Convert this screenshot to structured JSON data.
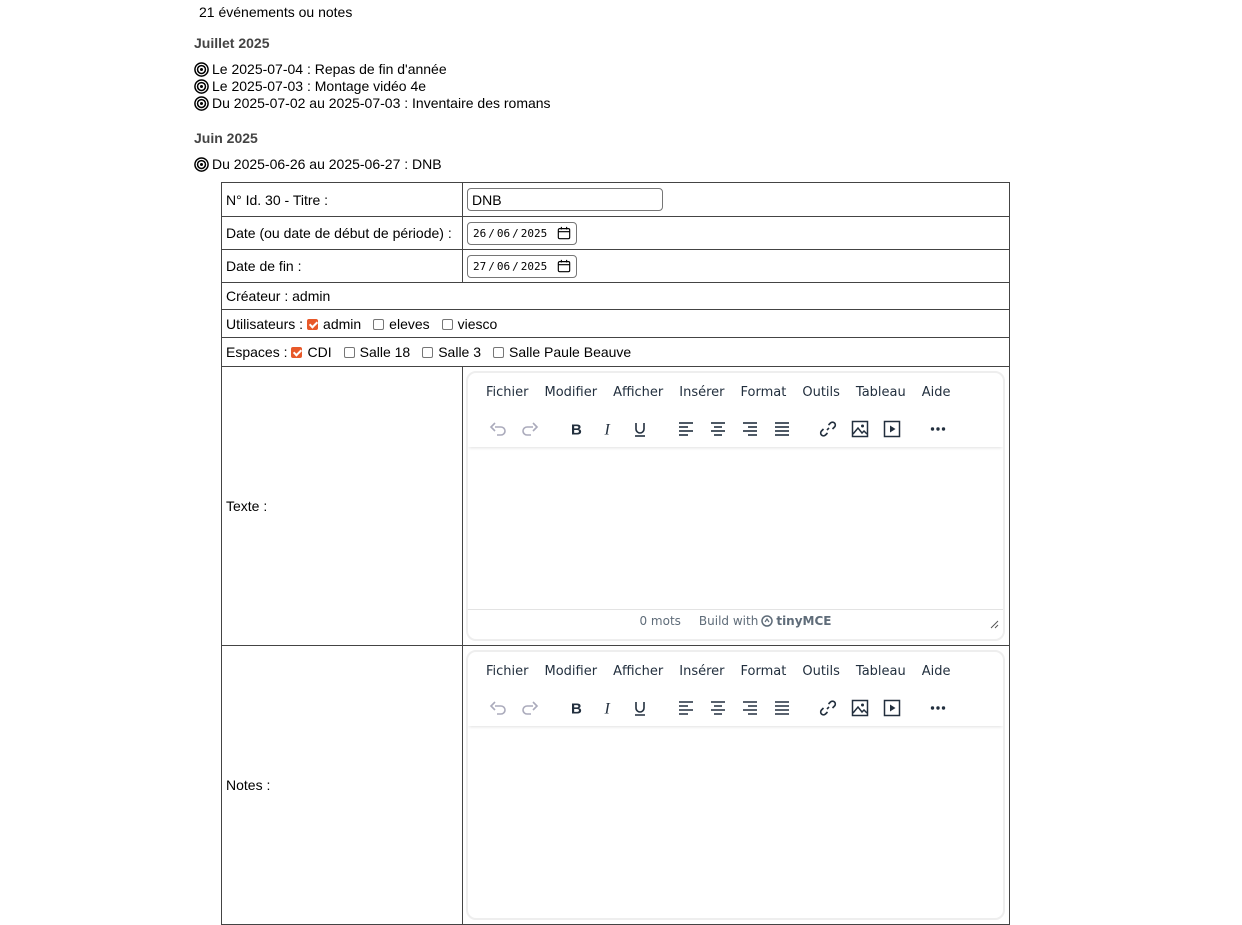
{
  "summary": "21 événements ou notes",
  "groups": [
    {
      "month": "Juillet 2025",
      "events": [
        "Le 2025-07-04 : Repas de fin d'année",
        "Le 2025-07-03 : Montage vidéo 4e",
        "Du 2025-07-02 au 2025-07-03 : Inventaire des romans"
      ]
    },
    {
      "month": "Juin 2025",
      "events": [
        "Du 2025-06-26 au 2025-06-27 : DNB"
      ]
    }
  ],
  "form": {
    "title_label": "N° Id. 30 - Titre :",
    "title_value": "DNB",
    "start_label": "Date (ou date de début de période) :",
    "start_day": "26",
    "start_month": "06",
    "start_year": "2025",
    "end_label": "Date de fin :",
    "end_day": "27",
    "end_month": "06",
    "end_year": "2025",
    "creator": "Créateur : admin",
    "users_label": "Utilisateurs :",
    "users": [
      {
        "label": "admin",
        "checked": true
      },
      {
        "label": "eleves",
        "checked": false
      },
      {
        "label": "viesco",
        "checked": false
      }
    ],
    "spaces_label": "Espaces :",
    "spaces": [
      {
        "label": "CDI",
        "checked": true
      },
      {
        "label": "Salle 18",
        "checked": false
      },
      {
        "label": "Salle 3",
        "checked": false
      },
      {
        "label": "Salle Paule Beauve",
        "checked": false
      }
    ],
    "text_label": "Texte :",
    "notes_label": "Notes :"
  },
  "editor": {
    "menu": [
      "Fichier",
      "Modifier",
      "Afficher",
      "Insérer",
      "Format",
      "Outils",
      "Tableau",
      "Aide"
    ],
    "word_count": "0 mots",
    "build_with": "Build with",
    "brand": "tinyMCE"
  },
  "colors": {
    "accent": "#e8592a",
    "menu_text": "#222f3e"
  }
}
